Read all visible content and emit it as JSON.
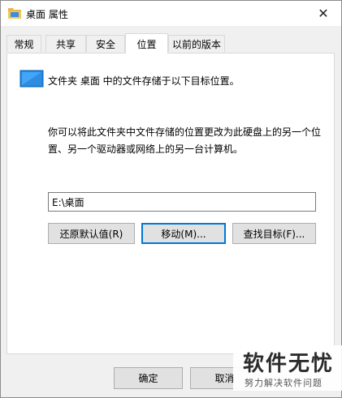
{
  "window": {
    "title": "桌面 属性",
    "close_glyph": "✕"
  },
  "tabs": [
    {
      "label": "常规",
      "active": false
    },
    {
      "label": "共享",
      "active": false
    },
    {
      "label": "安全",
      "active": false
    },
    {
      "label": "位置",
      "active": true
    },
    {
      "label": "以前的版本",
      "active": false
    }
  ],
  "location": {
    "icon": "desktop-folder-icon",
    "description": "文件夹 桌面 中的文件存储于以下目标位置。",
    "explanation": "你可以将此文件夹中文件存储的位置更改为此硬盘上的另一个位置、另一个驱动器或网络上的另一台计算机。",
    "path_value": "E:\\桌面",
    "restore_button": "还原默认值(R)",
    "move_button": "移动(M)...",
    "find_target_button": "查找目标(F)..."
  },
  "footer": {
    "ok_button": "确定",
    "cancel_button": "取消"
  },
  "watermark": {
    "title": "软件无忧",
    "subtitle": "努力解决软件问题"
  },
  "colors": {
    "accent": "#0078d7",
    "icon_blue": "#1e88e5"
  }
}
